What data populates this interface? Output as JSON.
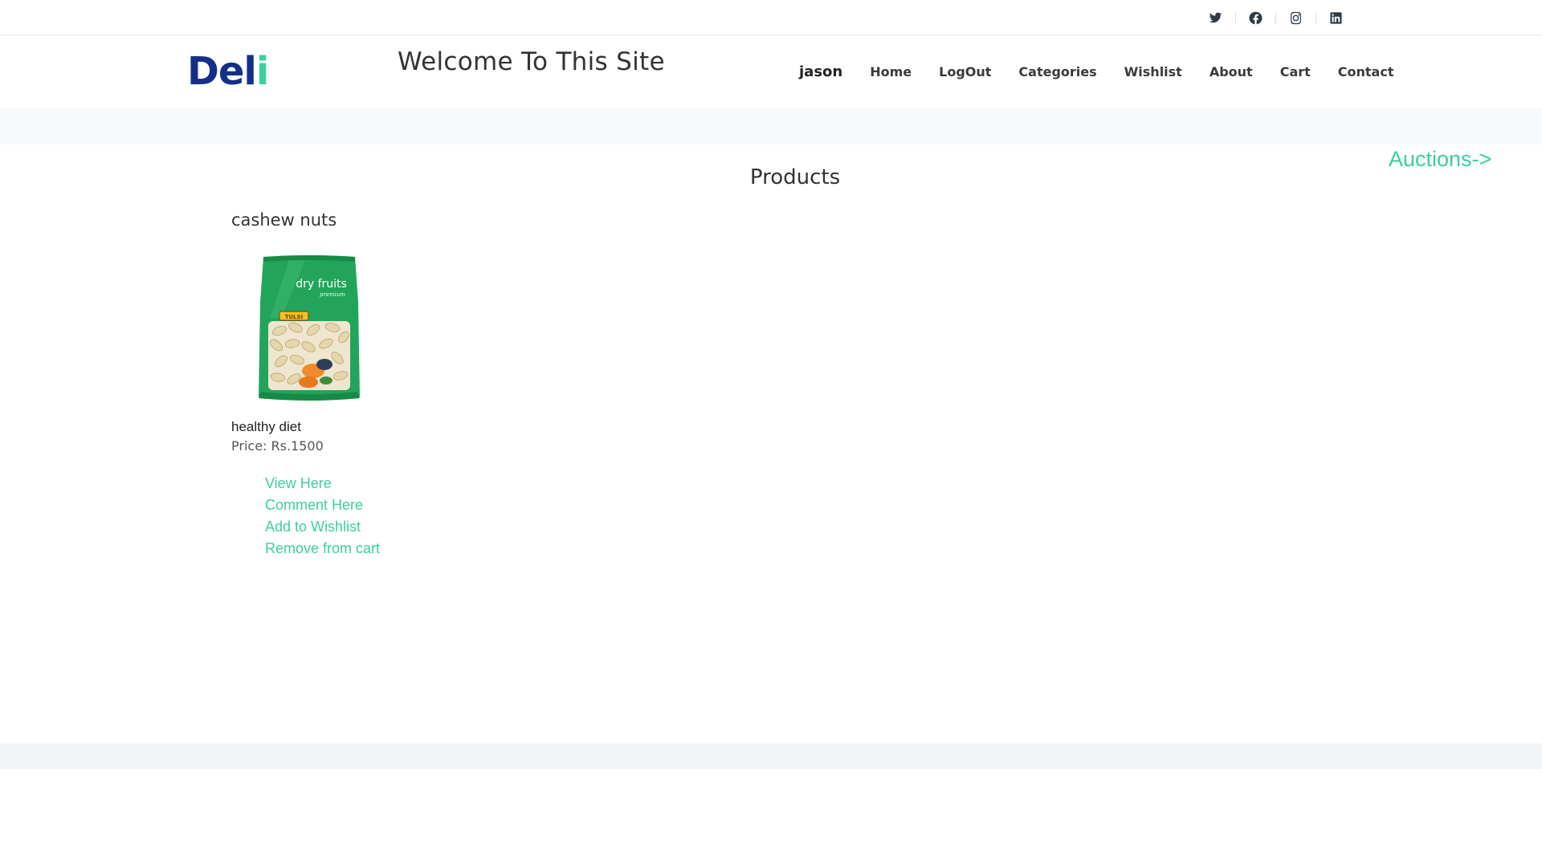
{
  "social": {
    "icons": [
      "twitter-icon",
      "facebook-icon",
      "instagram-icon",
      "linkedin-icon"
    ]
  },
  "header": {
    "logo_main": "Del",
    "logo_accent": "i",
    "welcome": "Welcome To This Site",
    "nav": {
      "user": "jason",
      "home": "Home",
      "logout": "LogOut",
      "categories": "Categories",
      "wishlist": "Wishlist",
      "about": "About",
      "cart": "Cart",
      "contact": "Contact"
    }
  },
  "main": {
    "auctions_link": "Auctions->",
    "title": "Products",
    "product": {
      "name": "cashew nuts",
      "package_text": "dry fruits",
      "package_subtext": "premium",
      "package_brand": "TULSI",
      "description": "healthy diet",
      "price": "Price: Rs.1500",
      "actions": {
        "view": "View Here",
        "comment": "Comment Here",
        "wishlist": "Add to Wishlist",
        "remove": "Remove from cart"
      }
    }
  },
  "colors": {
    "brand_blue": "#12308a",
    "accent_green": "#3ccf9b",
    "text_dark": "#333333"
  }
}
